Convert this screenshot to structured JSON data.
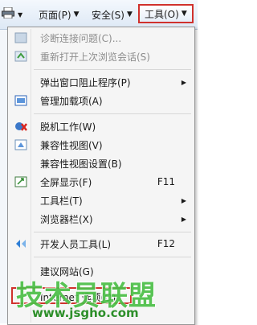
{
  "toolbar": {
    "page_label": "页面(P)",
    "safety_label": "安全(S)",
    "tools_label": "工具(O)"
  },
  "menu": {
    "items": [
      {
        "label": "诊断连接问题(C)...",
        "disabled": true
      },
      {
        "label": "重新打开上次浏览会话(S)",
        "disabled": true
      },
      {
        "label": "弹出窗口阻止程序(P)"
      },
      {
        "label": "管理加载项(A)"
      },
      {
        "label": "脱机工作(W)"
      },
      {
        "label": "兼容性视图(V)"
      },
      {
        "label": "兼容性视图设置(B)"
      },
      {
        "label": "全屏显示(F)",
        "shortcut": "F11"
      },
      {
        "label": "工具栏(T)"
      },
      {
        "label": "浏览器栏(X)"
      },
      {
        "label": "开发人员工具(L)",
        "shortcut": "F12"
      },
      {
        "label": "建议网站(G)"
      },
      {
        "label": "Internet 选项(O)"
      }
    ]
  },
  "watermark": {
    "title": "技术员联盟",
    "url": "www.jsgho.com"
  },
  "colors": {
    "highlight": "#d0312d",
    "watermark": "#4bbf47"
  }
}
